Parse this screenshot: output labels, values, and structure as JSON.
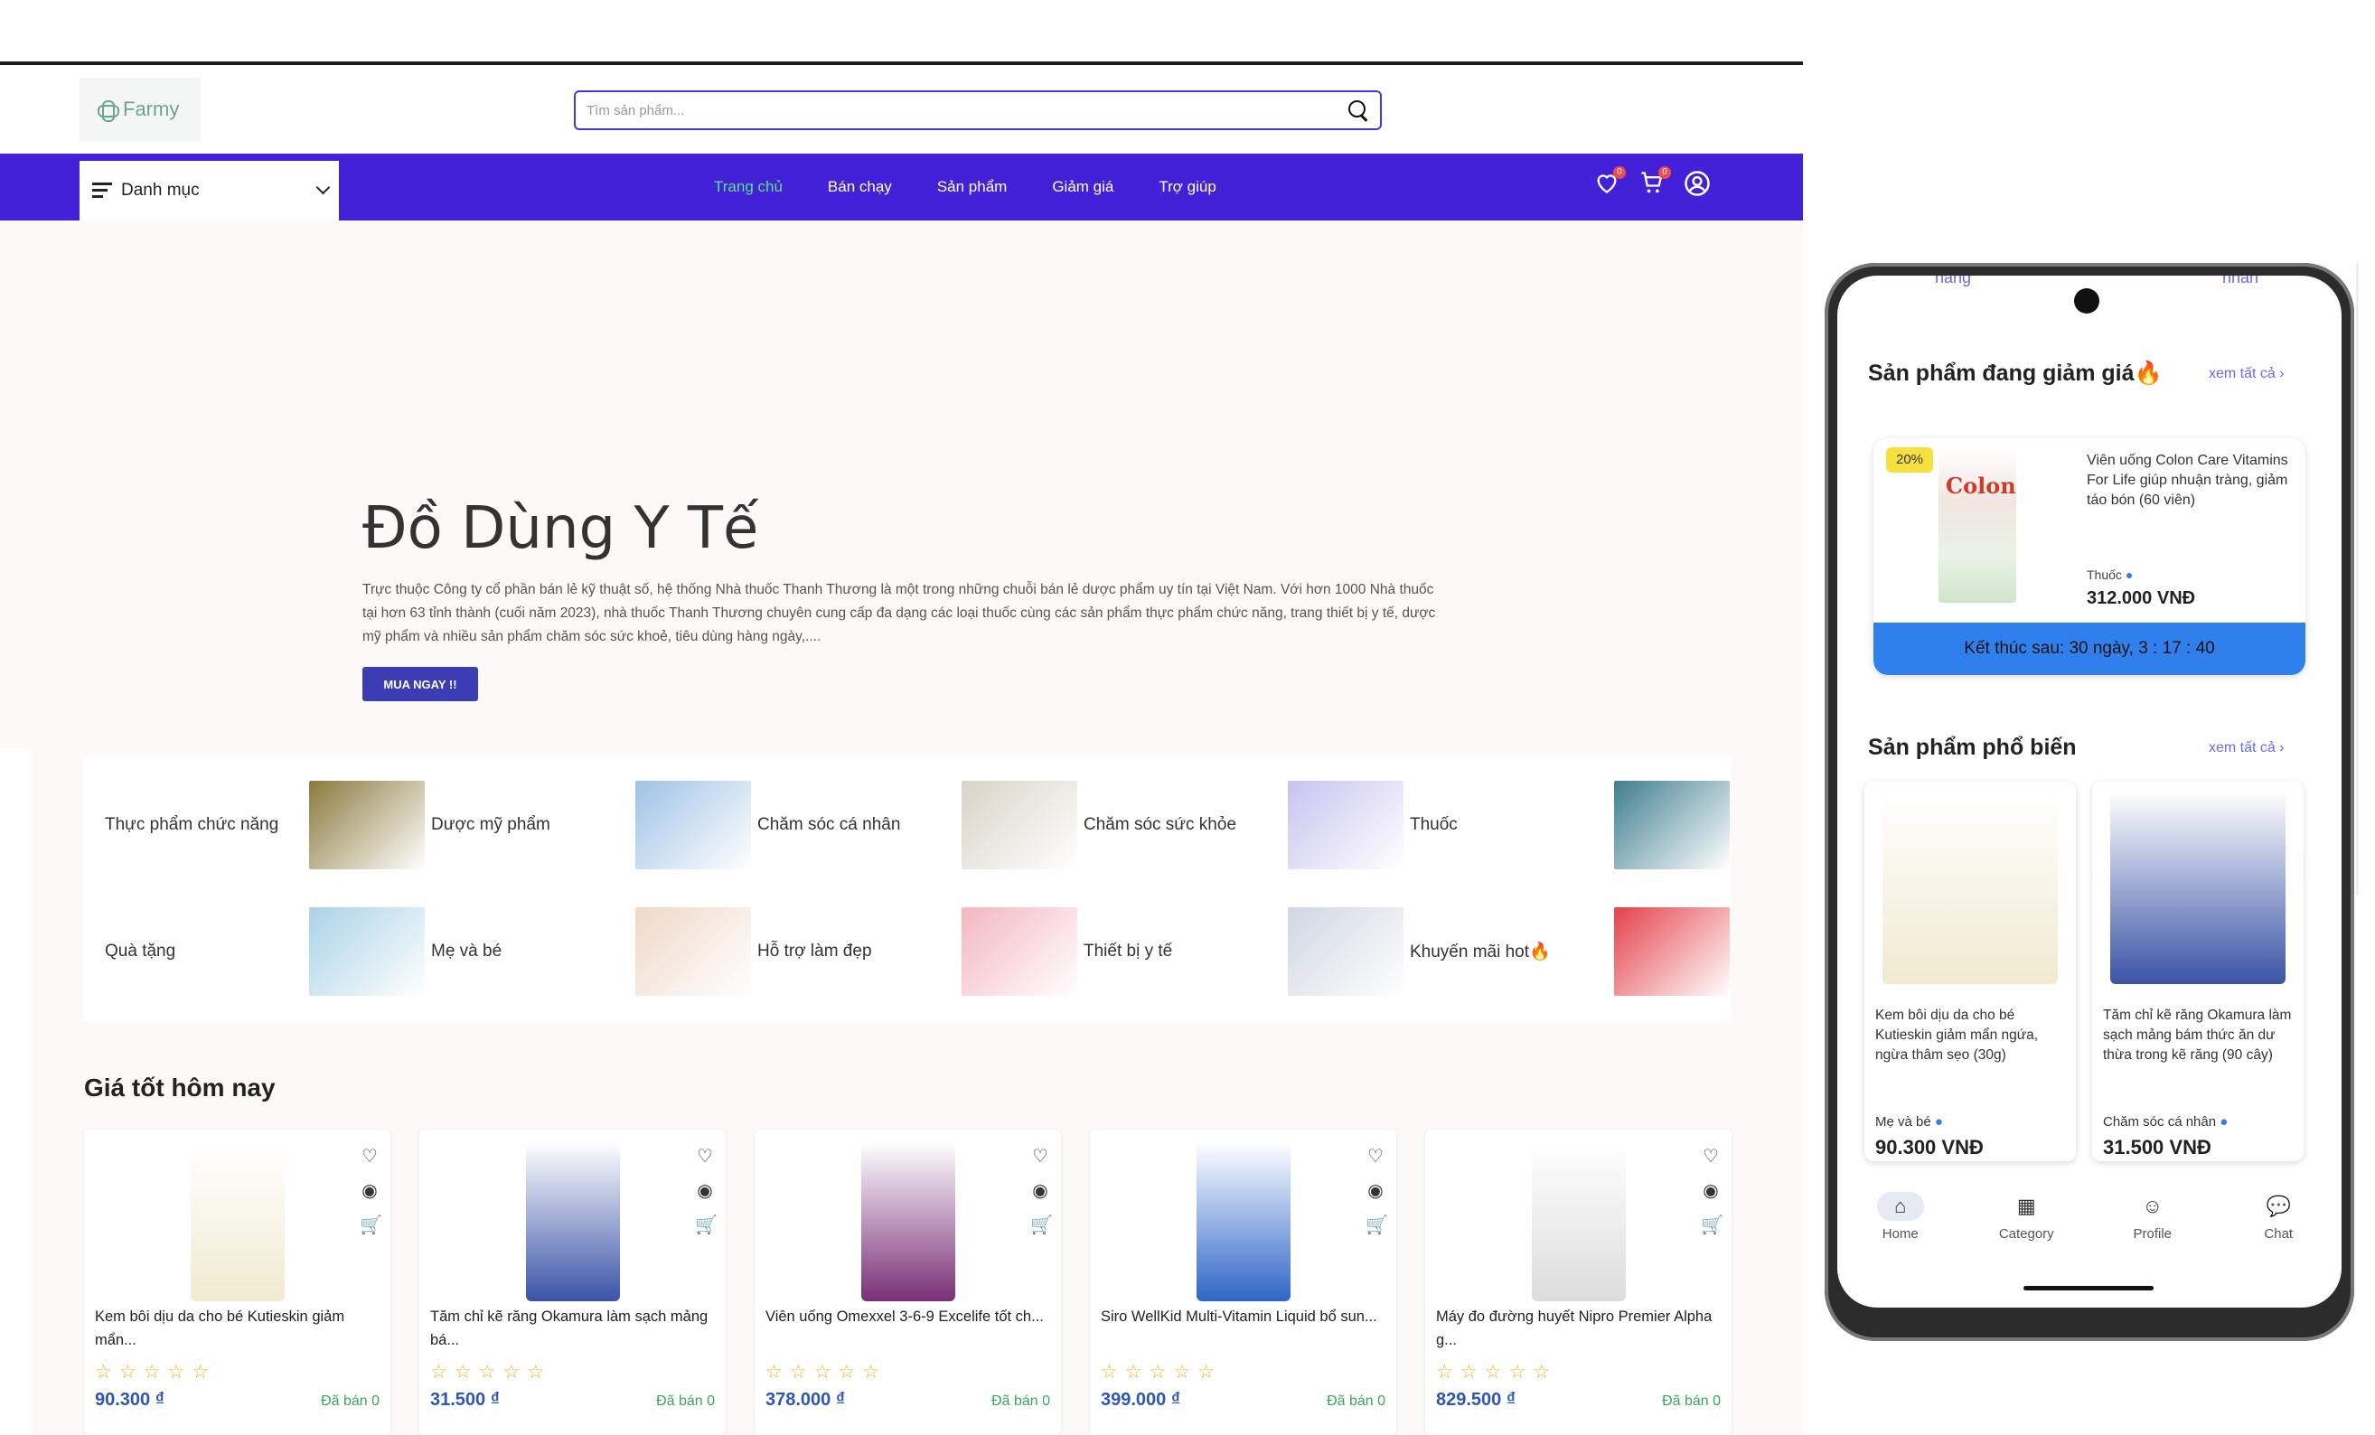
{
  "site": {
    "logo_text": "Farmy",
    "search_placeholder": "Tìm sản phẩm...",
    "category_button": "Danh mục",
    "nav": [
      "Trang chủ",
      "Bán chạy",
      "Sản phẩm",
      "Giảm giá",
      "Trợ giúp"
    ],
    "wishlist_count": "0",
    "cart_count": "0",
    "hero": {
      "title": "Đồ Dùng Y Tế",
      "description": "Trực thuộc Công ty cổ phần bán lẻ kỹ thuật số, hệ thống Nhà thuốc Thanh Thương là một trong những chuỗi bán lẻ dược phẩm uy tín tại Việt Nam. Với hơn 1000 Nhà thuốc tại hơn 63 tỉnh thành (cuối năm 2023), nhà thuốc Thanh Thương chuyên cung cấp đa dạng các loại thuốc cùng các sản phẩm thực phẩm chức năng, trang thiết bị y tế, dược mỹ phẩm và nhiều sản phẩm chăm sóc sức khoẻ, tiêu dùng hàng ngày,....",
      "button": "MUA NGAY !!"
    },
    "categories": [
      {
        "label": "Thực phẩm chức năng",
        "color": "#8a7a3c"
      },
      {
        "label": "Dược mỹ phẩm",
        "color": "#9ec3e6"
      },
      {
        "label": "Chăm sóc cá nhân",
        "color": "#d9d3c7"
      },
      {
        "label": "Chăm sóc sức khỏe",
        "color": "#c8c3f0"
      },
      {
        "label": "Thuốc",
        "color": "#3f7e8f"
      },
      {
        "label": "Quà tặng",
        "color": "#a9d3e6"
      },
      {
        "label": "Mẹ và bé",
        "color": "#efd9c8"
      },
      {
        "label": "Hỗ trợ làm đẹp",
        "color": "#f3b6c1"
      },
      {
        "label": "Thiết bị y tế",
        "color": "#d0d6e2"
      },
      {
        "label": "Khuyến mãi hot🔥",
        "color": "#e3424a"
      }
    ],
    "deals_title": "Giá tốt hôm nay",
    "products": [
      {
        "name": "Kem bôi dịu da cho bé Kutieskin giảm mẩn...",
        "price": "90.300 ₫",
        "sold": "Đã bán 0",
        "color": "#f1ead0"
      },
      {
        "name": "Tăm chỉ kẽ răng Okamura làm sạch mảng bá...",
        "price": "31.500 ₫",
        "sold": "Đã bán 0",
        "color": "#3a54a6"
      },
      {
        "name": "Viên uống Omexxel 3-6-9 Excelife tốt ch...",
        "price": "378.000 ₫",
        "sold": "Đã bán 0",
        "color": "#7a2f78"
      },
      {
        "name": "Siro WellKid Multi-Vitamin Liquid bổ sun...",
        "price": "399.000 ₫",
        "sold": "Đã bán 0",
        "color": "#2f66c8"
      },
      {
        "name": "Máy đo đường huyết Nipro Premier Alpha g...",
        "price": "829.500 ₫",
        "sold": "Đã bán 0",
        "color": "#dcdcdc"
      }
    ],
    "stars": "☆☆☆☆☆"
  },
  "mobile": {
    "top_peek": [
      "hàng",
      "nhấn"
    ],
    "sale_section": "Sản phẩm đang giảm giá🔥",
    "see_all": "xem tất cả ›",
    "sale_item": {
      "discount": "20%",
      "brand": "Colon",
      "name": "Viên uống Colon Care Vitamins For Life giúp nhuận tràng, giảm táo bón (60 viên)",
      "category": "Thuốc",
      "price": "312.000 VNĐ",
      "timer": "Kết thúc sau: 30 ngày, 3 : 17 : 40"
    },
    "popular_section": "Sản phẩm phổ biến",
    "popular_see_all": "xem tất cả ›",
    "popular": [
      {
        "name": "Kem bôi dịu da cho bé Kutieskin giảm mẩn ngứa, ngừa thâm sẹo (30g)",
        "category": "Mẹ và bé",
        "price": "90.300 VNĐ",
        "color": "#f1ead0"
      },
      {
        "name": "Tăm chỉ kẽ răng Okamura làm sạch mảng bám thức ăn dư thừa trong kẽ răng (90 cây)",
        "category": "Chăm sóc cá nhân",
        "price": "31.500 VNĐ",
        "color": "#3a54a6"
      }
    ],
    "bottom_nav": [
      {
        "label": "Home",
        "icon": "home-icon"
      },
      {
        "label": "Category",
        "icon": "grid-icon"
      },
      {
        "label": "Profile",
        "icon": "user-icon"
      },
      {
        "label": "Chat",
        "icon": "chat-icon"
      }
    ]
  }
}
